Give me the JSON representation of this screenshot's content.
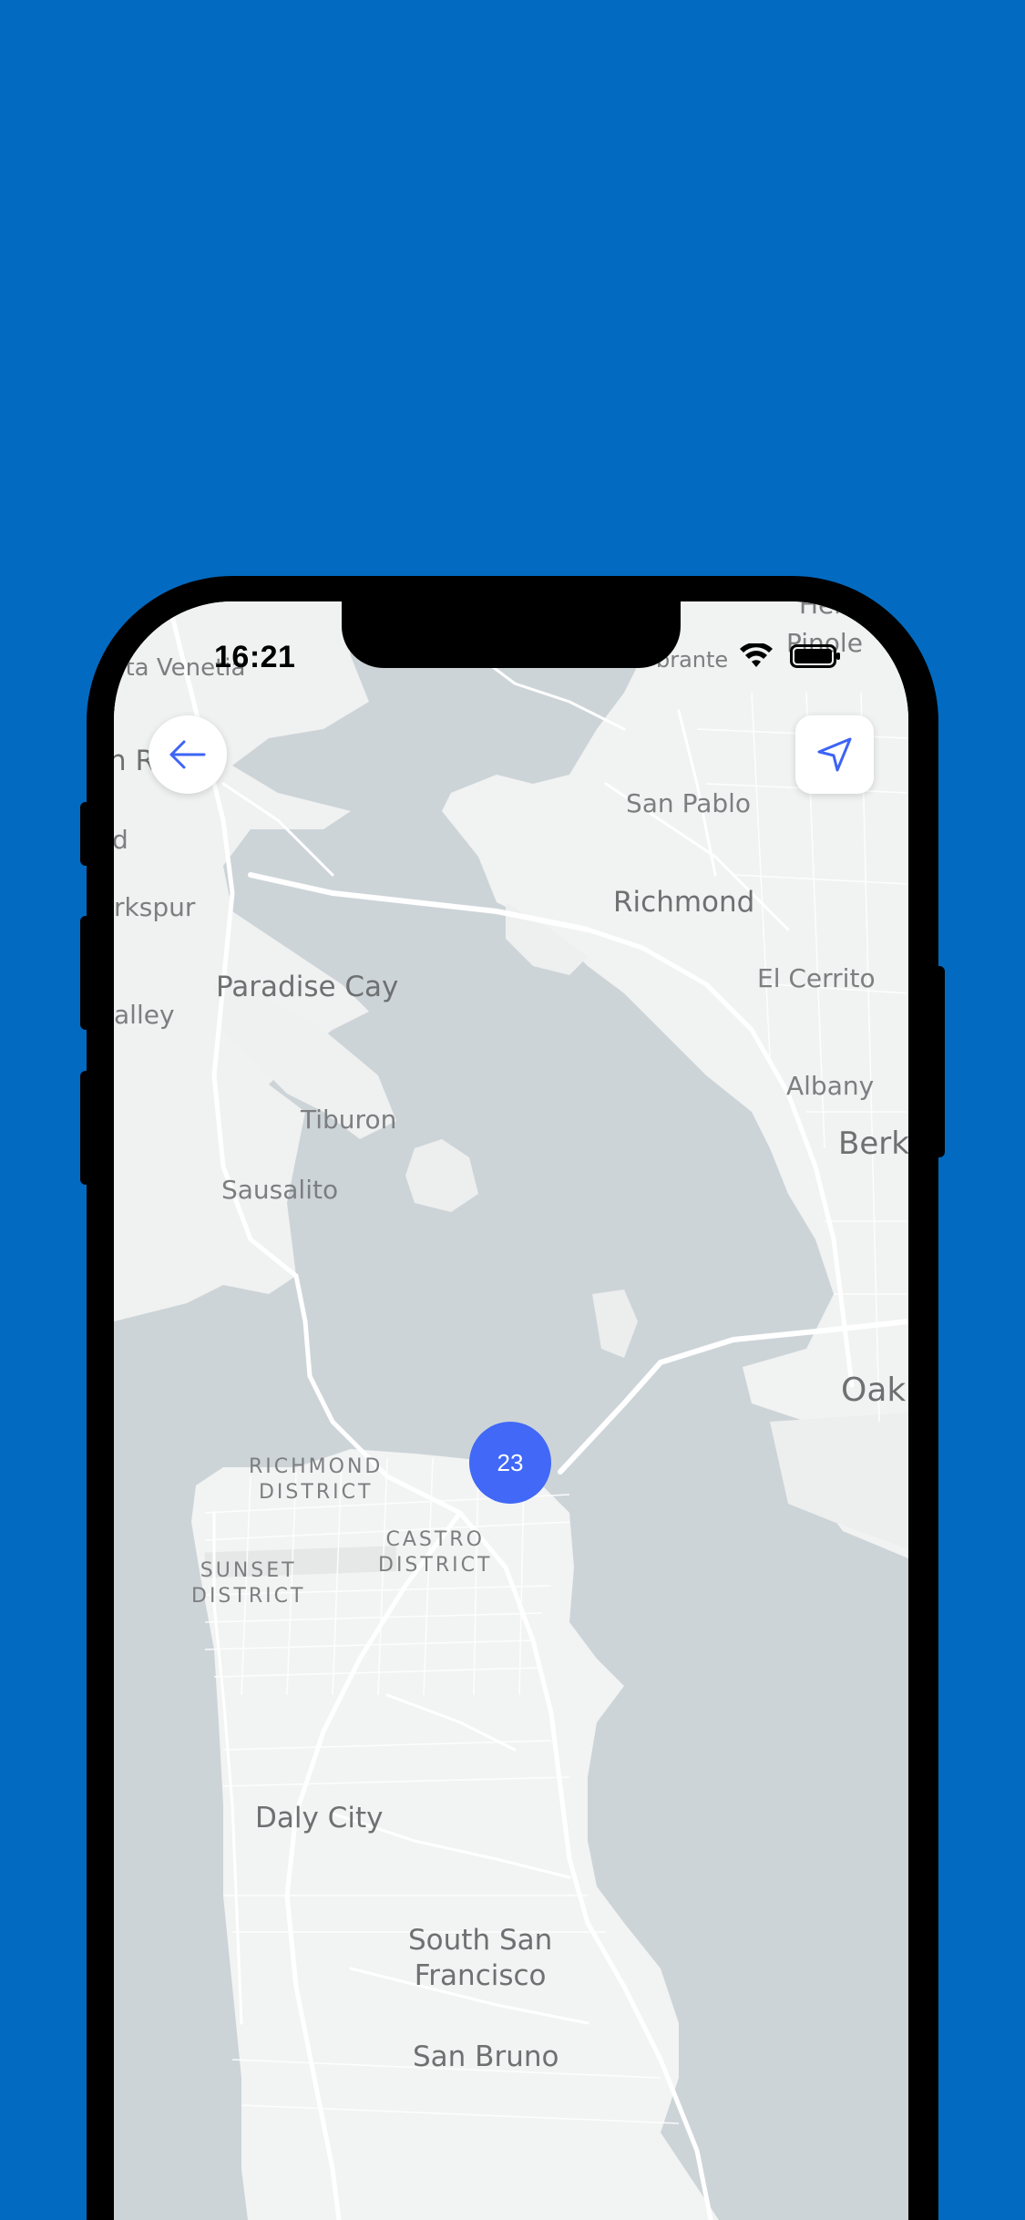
{
  "status_bar": {
    "time": "16:21"
  },
  "map": {
    "labels": {
      "santa_venetia": "nta Venetia",
      "san_rafael": "n R",
      "larkspur_d": "d",
      "larkspur": "rkspur",
      "valley": "alley",
      "paradise_cay": "Paradise Cay",
      "tiburon": "Tiburon",
      "sausalito": "Sausalito",
      "el_sobrante": "brante",
      "pinole_top": "Her",
      "pinole": "Pinole",
      "san_pablo": "San Pablo",
      "richmond": "Richmond",
      "el_cerrito": "El Cerrito",
      "albany": "Albany",
      "berkeley": "Berk",
      "oakland": "Oak",
      "richmond_district": "RICHMOND\nDISTRICT",
      "castro_district": "CASTRO\nDISTRICT",
      "sunset_district": "SUNSET\nDISTRICT",
      "daly_city": "Daly City",
      "south_san_francisco": "South San\nFrancisco",
      "san_bruno": "San Bruno"
    },
    "cluster_count": "23",
    "colors": {
      "water": "#CDD4D8",
      "land": "#F2F3F3",
      "roads": "#FFFFFF",
      "accent": "#4168F6",
      "background": "#026BC1"
    }
  },
  "controls": {
    "back_icon": "arrow-left-icon",
    "locate_icon": "navigation-arrow-icon"
  }
}
